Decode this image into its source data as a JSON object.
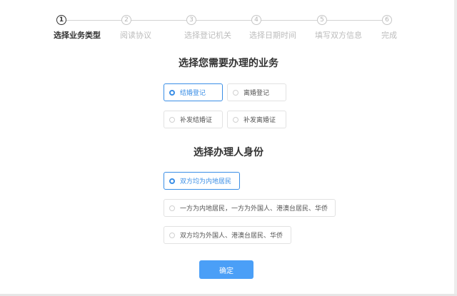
{
  "steps": [
    {
      "number": "1",
      "label": "选择业务类型",
      "state": "active"
    },
    {
      "number": "2",
      "label": "阅读协议",
      "state": "pending"
    },
    {
      "number": "3",
      "label": "选择登记机关",
      "state": "pending"
    },
    {
      "number": "4",
      "label": "选择日期时间",
      "state": "pending"
    },
    {
      "number": "5",
      "label": "填写双方信息",
      "state": "pending"
    },
    {
      "number": "6",
      "label": "完成",
      "state": "pending"
    }
  ],
  "business": {
    "title": "选择您需要办理的业务",
    "options": [
      {
        "label": "结婚登记",
        "selected": true
      },
      {
        "label": "离婚登记",
        "selected": false
      },
      {
        "label": "补发结婚证",
        "selected": false
      },
      {
        "label": "补发离婚证",
        "selected": false
      }
    ]
  },
  "identity": {
    "title": "选择办理人身份",
    "options": [
      {
        "label": "双方均为内地居民",
        "selected": true
      },
      {
        "label": "一方为内地居民，一方为外国人、港澳台居民、华侨",
        "selected": false
      },
      {
        "label": "双方均为外国人、港澳台居民、华侨",
        "selected": false
      }
    ]
  },
  "confirm_label": "确定",
  "colors": {
    "accent": "#3a8ee6",
    "button": "#4b9ff7"
  }
}
